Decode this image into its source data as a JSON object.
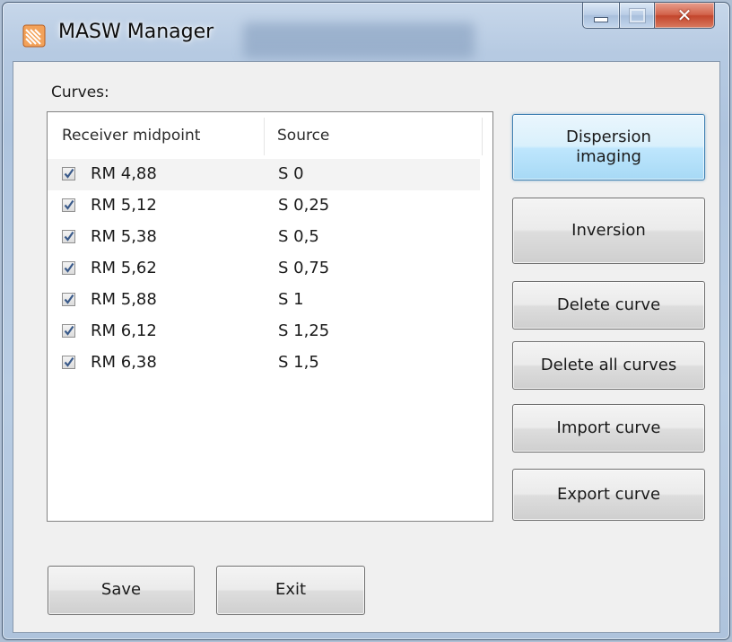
{
  "window": {
    "title": "MASW Manager"
  },
  "curves_label": "Curves:",
  "list": {
    "columns": [
      "Receiver midpoint",
      "Source"
    ],
    "rows": [
      {
        "checked": true,
        "midpoint": "RM 4,88",
        "source": "S 0"
      },
      {
        "checked": true,
        "midpoint": "RM 5,12",
        "source": "S 0,25"
      },
      {
        "checked": true,
        "midpoint": "RM 5,38",
        "source": "S 0,5"
      },
      {
        "checked": true,
        "midpoint": "RM 5,62",
        "source": "S 0,75"
      },
      {
        "checked": true,
        "midpoint": "RM 5,88",
        "source": "S 1"
      },
      {
        "checked": true,
        "midpoint": "RM 6,12",
        "source": "S 1,25"
      },
      {
        "checked": true,
        "midpoint": "RM 6,38",
        "source": "S 1,5"
      }
    ]
  },
  "buttons": {
    "dispersion": "Dispersion imaging",
    "inversion": "Inversion",
    "delete_curve": "Delete curve",
    "delete_all": "Delete all curves",
    "import_curve": "Import curve",
    "export_curve": "Export curve",
    "save": "Save",
    "exit": "Exit"
  },
  "icons": {
    "app": "masw-app-icon",
    "minimize": "minimize-icon",
    "maximize": "maximize-icon",
    "close": "close-icon",
    "checkbox": "checkmark-icon"
  },
  "colors": {
    "focus_button": "#bee6fd",
    "close_button": "#c3452c",
    "frame": "#b6cae2"
  }
}
